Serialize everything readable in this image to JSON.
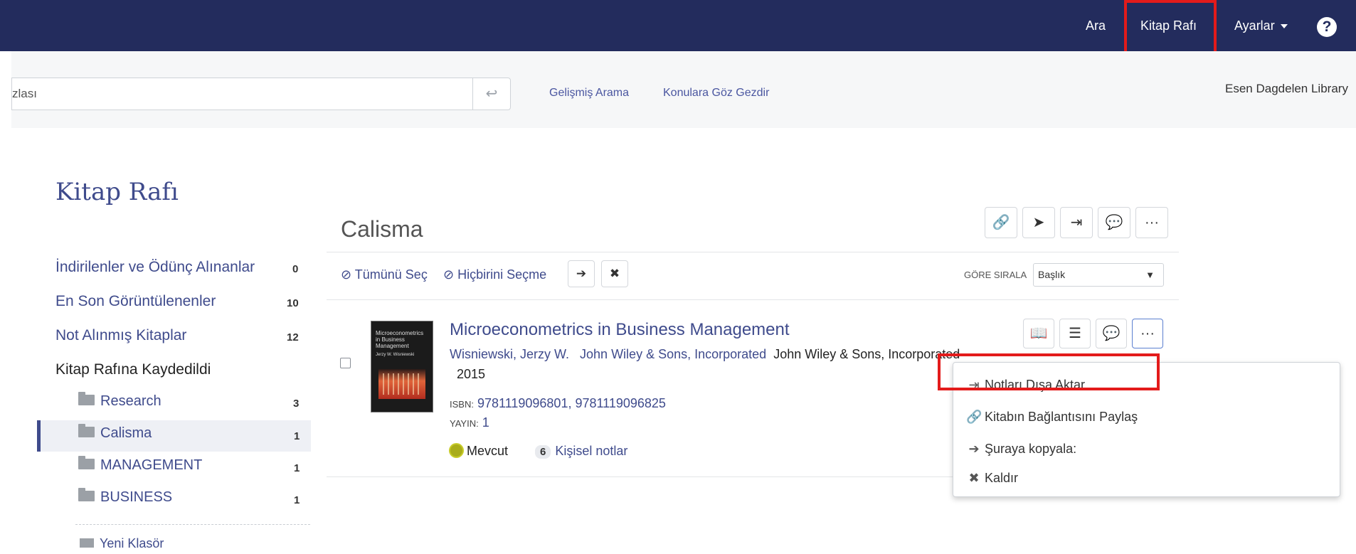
{
  "topbar": {
    "search": "Ara",
    "bookshelf": "Kitap Rafı",
    "settings": "Ayarlar",
    "help": "?"
  },
  "searchbar": {
    "query": "zlası",
    "advanced": "Gelişmiş Arama",
    "browse": "Konulara Göz Gezdir",
    "library": "Esen Dagdelen Library"
  },
  "page_title": "Kitap Rafı",
  "sidebar": {
    "items": [
      {
        "label": "İndirilenler ve Ödünç Alınanlar",
        "count": "0"
      },
      {
        "label": "En Son Görüntülenenler",
        "count": "10"
      },
      {
        "label": "Not Alınmış Kitaplar",
        "count": "12"
      },
      {
        "label": "Kitap Rafına Kaydedildi"
      }
    ],
    "folders": [
      {
        "label": "Research",
        "count": "3"
      },
      {
        "label": "Calisma",
        "count": "1"
      },
      {
        "label": "MANAGEMENT",
        "count": "1"
      },
      {
        "label": "BUSINESS",
        "count": "1"
      }
    ],
    "new_folder": "Yeni Klasör"
  },
  "main": {
    "title": "Calisma",
    "select_all": "Tümünü Seç",
    "select_none": "Hiçbirini Seçme",
    "sort_label": "GÖRE SIRALA",
    "sort_value": "Başlık"
  },
  "record": {
    "title": "Microeconometrics in Business Management",
    "author": "Wisniewski, Jerzy W.",
    "publisher_link": "John Wiley & Sons, Incorporated",
    "publisher": "John Wiley & Sons, Incorporated",
    "year": "2015",
    "isbn_label": "ISBN:",
    "isbn": "9781119096801, 9781119096825",
    "edition_label": "YAYIN:",
    "edition": "1",
    "availability": "Mevcut",
    "notes_count": "6",
    "notes_label": "Kişisel notlar",
    "cover_text": "Microeconometrics in Business Management",
    "cover_author": "Jerzy W. Wisniewski"
  },
  "dropdown": {
    "export_notes": "Notları Dışa Aktar",
    "share_link": "Kitabın Bağlantısını Paylaş",
    "copy_to": "Şuraya kopyala:",
    "remove": "Kaldır"
  },
  "colors": {
    "nav_bg": "#232c5d",
    "link": "#3f4b8c",
    "highlight": "#e31b1b",
    "available": "#a9ad1a"
  }
}
